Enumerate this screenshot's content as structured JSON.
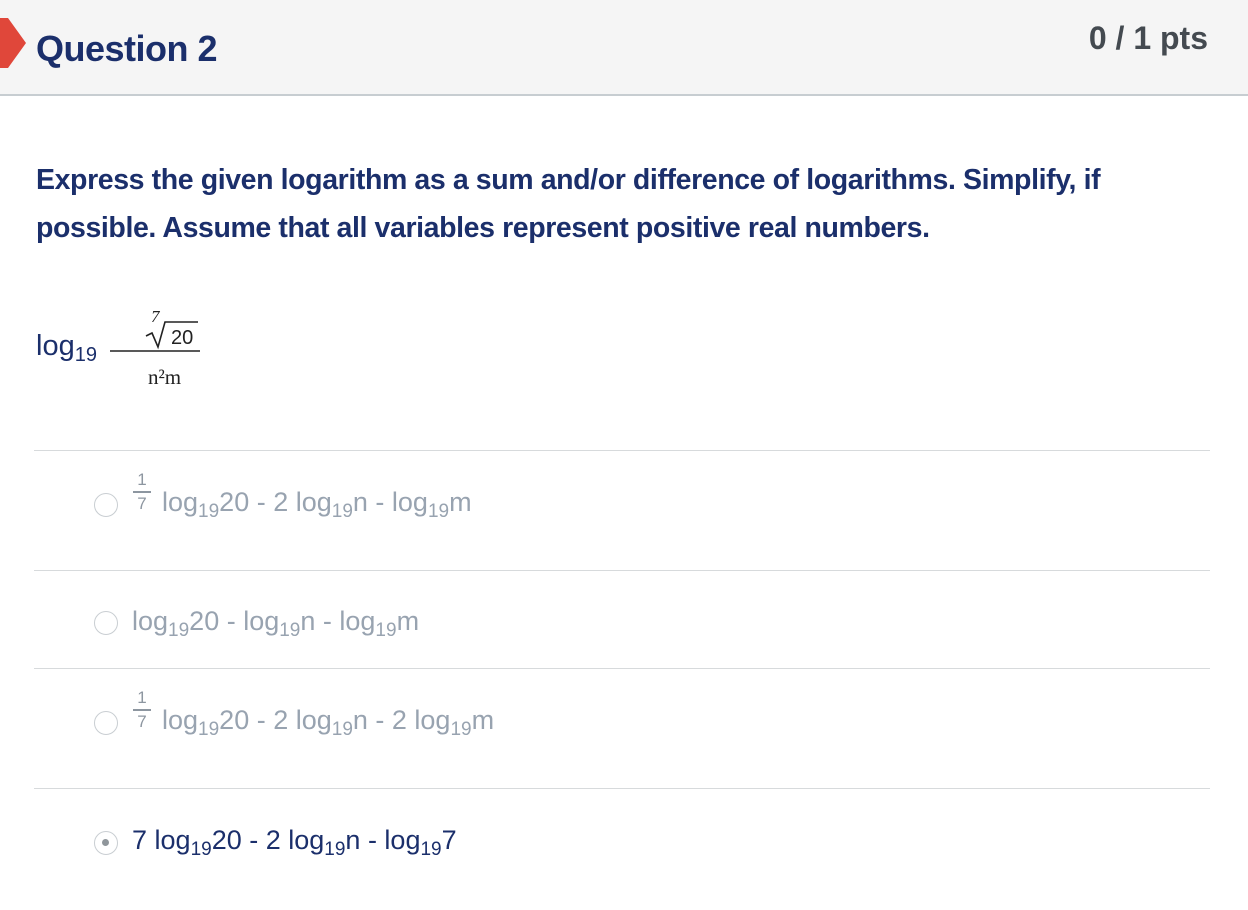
{
  "question": {
    "title": "Question 2",
    "points": "0 / 1 pts",
    "text": "Express the given logarithm as a sum and/or difference of logarithms. Simplify, if possible. Assume that all variables represent positive real numbers.",
    "expression": {
      "log_word": "log",
      "base": "19",
      "root_index": "7",
      "radicand": "20",
      "denominator": "n²m"
    }
  },
  "answers": [
    {
      "fraction": {
        "num": "1",
        "den": "7"
      },
      "parts": [
        "log",
        "19",
        "20 - 2 log",
        "19",
        "n - log",
        "19",
        "m"
      ],
      "selected": false
    },
    {
      "parts": [
        "log",
        "19",
        "20 - log",
        "19",
        "n - log",
        "19",
        "m"
      ],
      "selected": false
    },
    {
      "fraction": {
        "num": "1",
        "den": "7"
      },
      "parts": [
        "log",
        "19",
        "20 - 2 log",
        "19",
        "n - 2 log",
        "19",
        "m"
      ],
      "selected": false
    },
    {
      "parts": [
        "7 log",
        "19",
        "20 - 2 log",
        "19",
        "n - log",
        "19",
        "7"
      ],
      "selected": true
    }
  ],
  "colors": {
    "heading": "#1b2f6b",
    "flag": "#e0473a",
    "muted_answer": "#98a3b0"
  }
}
